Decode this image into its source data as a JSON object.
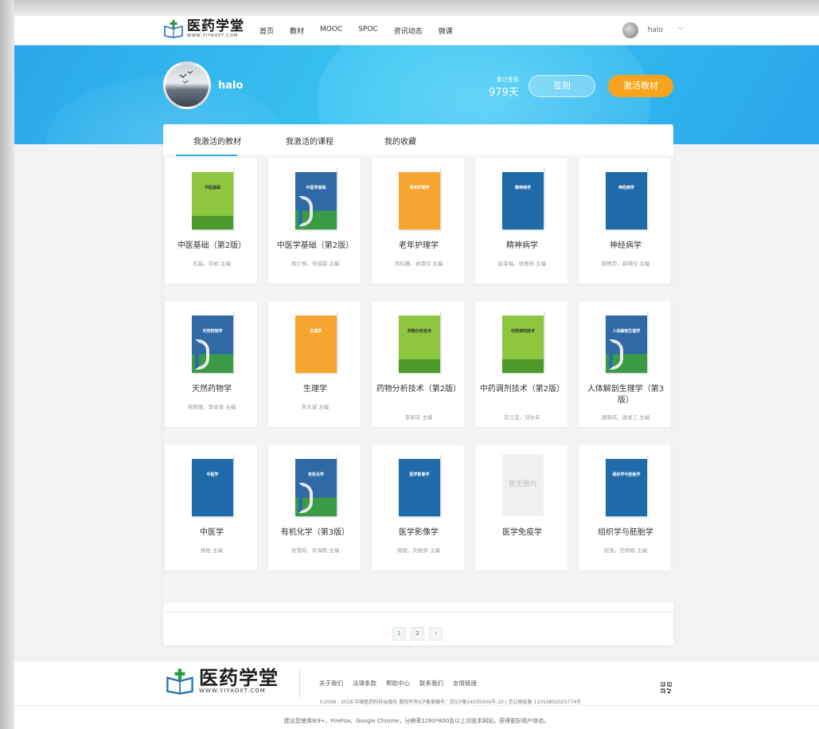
{
  "nav": {
    "logo_cn": "医药学堂",
    "logo_en": "WWW.YIYAOXT.COM",
    "links": [
      "首页",
      "教材",
      "MOOC",
      "SPOC",
      "资讯动态",
      "微课"
    ],
    "user_name": "halo",
    "user_caret": "﹀"
  },
  "banner": {
    "user_name": "halo",
    "signin_label": "累计签到",
    "signin_days": "979天",
    "sign_button": "签到",
    "activate_button": "激活教材"
  },
  "tabs": [
    "我激活的教材",
    "我激活的课程",
    "我的收藏"
  ],
  "books": [
    {
      "title": "中医基础（第2版）",
      "author": "石磊，邓岩 主编",
      "cover_title": "中医基础"
    },
    {
      "title": "中医学基础（第2版）",
      "author": "周少林，宋诚挚 主编",
      "cover_title": "中医学基础"
    },
    {
      "title": "老年护理学",
      "author": "邓科穗，钟清玲 主编",
      "cover_title": "老年护理学"
    },
    {
      "title": "精神病学",
      "author": "赵幸福，张丽芳 主编",
      "cover_title": "精神病学"
    },
    {
      "title": "神经病学",
      "author": "郭艳芹，郭晓玲 主编",
      "cover_title": "神经病学"
    },
    {
      "title": "天然药物学",
      "author": "祖矩雄，李本俊 主编",
      "cover_title": "天然药物学"
    },
    {
      "title": "生理学",
      "author": "朱大诚 主编",
      "cover_title": "生理学"
    },
    {
      "title": "药物分析技术（第2版）",
      "author": "李家庆 主编",
      "cover_title": "药物分析技术"
    },
    {
      "title": "中药调剂技术（第2版）",
      "author": "苏兰宜，邓仕年",
      "cover_title": "中药调剂技术"
    },
    {
      "title": "人体解剖生理学（第3版）",
      "author": "唐晓伟，唐省三 主编",
      "cover_title": "人体解剖生理学"
    },
    {
      "title": "中医学",
      "author": "杨柱 主编",
      "cover_title": "中医学"
    },
    {
      "title": "有机化学（第3版）",
      "author": "张雪昀，宋海南 主编",
      "cover_title": "有机化学"
    },
    {
      "title": "医学影像学",
      "author": "郑健，刘振师 主编",
      "cover_title": "医学影像学"
    },
    {
      "title": "医学免疫学",
      "author": "",
      "cover_title": "暂无图片"
    },
    {
      "title": "组织学与胚胎学",
      "author": "段斐，任明姬 主编",
      "cover_title": "组织学与胚胎学"
    }
  ],
  "pager": {
    "pages": [
      "1",
      "2"
    ],
    "next": "›"
  },
  "footer": {
    "logo_cn": "医药学堂",
    "logo_en": "WWW.YIYAOXT.COM",
    "links": [
      "关于我们",
      "法律条款",
      "帮助中心",
      "联系我们",
      "友情链接"
    ],
    "copyright": "©2006 - 2018 中国医药科技出版社 版权所有ICP备案编号：京ICP备14035006号-10 | 京公网安备 11010802025774号",
    "browser_tip": "建议您使用IE9+、FireFox、Google Chrome，分辨率1280*800及以上浏览本网站，获得更好用户体验。"
  }
}
